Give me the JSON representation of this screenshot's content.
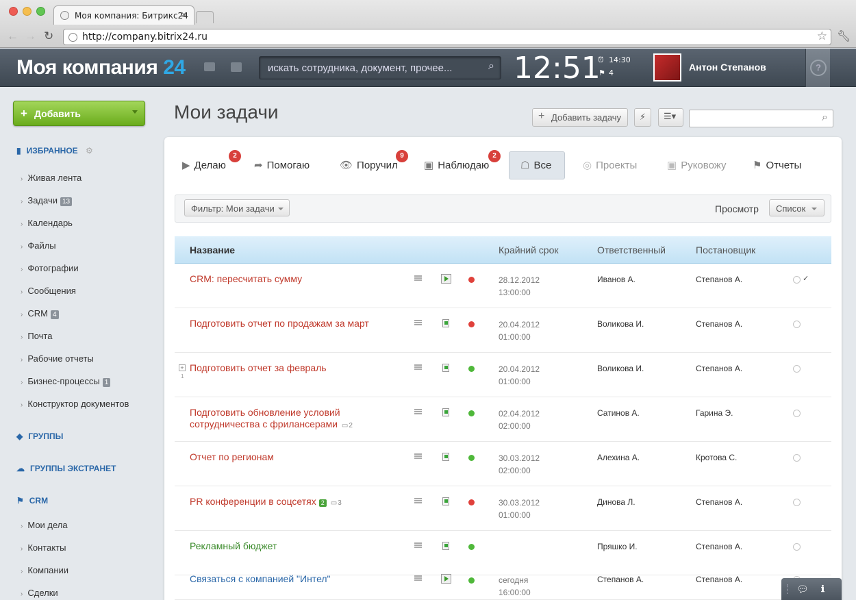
{
  "browser": {
    "tab_title": "Моя компания: Битрикс24",
    "url": "http://company.bitrix24.ru"
  },
  "header": {
    "logo_text": "Моя компания",
    "logo_number": "24",
    "search_placeholder": "искать сотрудника, документ, прочее...",
    "clock": "12:51",
    "alarm_time": "14:30",
    "flag_count": "4",
    "user_name": "Антон Степанов",
    "help_label": "?"
  },
  "sidebar": {
    "add_button": "Добавить",
    "favorites_title": "ИЗБРАННОЕ",
    "favorites": [
      {
        "label": "Живая лента",
        "count": ""
      },
      {
        "label": "Задачи",
        "count": "13"
      },
      {
        "label": "Календарь",
        "count": ""
      },
      {
        "label": "Файлы",
        "count": ""
      },
      {
        "label": "Фотографии",
        "count": ""
      },
      {
        "label": "Сообщения",
        "count": ""
      },
      {
        "label": "CRM",
        "count": "4"
      },
      {
        "label": "Почта",
        "count": ""
      },
      {
        "label": "Рабочие отчеты",
        "count": ""
      },
      {
        "label": "Бизнес-процессы",
        "count": "1"
      },
      {
        "label": "Конструктор документов",
        "count": ""
      }
    ],
    "groups_title": "ГРУППЫ",
    "extranet_title": "ГРУППЫ ЭКСТРАНЕТ",
    "crm_title": "CRM",
    "crm_items": [
      "Мои дела",
      "Контакты",
      "Компании",
      "Сделки"
    ]
  },
  "page": {
    "title": "Мои задачи",
    "add_task_button": "Добавить задачу"
  },
  "filter_tabs": [
    {
      "label": "Делаю",
      "badge": "2"
    },
    {
      "label": "Помогаю",
      "badge": ""
    },
    {
      "label": "Поручил",
      "badge": "9"
    },
    {
      "label": "Наблюдаю",
      "badge": "2"
    },
    {
      "label": "Все",
      "badge": ""
    },
    {
      "label": "Проекты",
      "badge": ""
    },
    {
      "label": "Руковожу",
      "badge": ""
    },
    {
      "label": "Отчеты",
      "badge": ""
    }
  ],
  "filter_bar": {
    "filter_label": "Фильтр: Мои задачи",
    "view_label": "Просмотр",
    "view_value": "Список"
  },
  "table": {
    "columns": [
      "Название",
      "Крайний срок",
      "Ответственный",
      "Постановщик"
    ],
    "rows": [
      {
        "name": "CRM: пересчитать сумму",
        "date": "28.12.2012",
        "time": "13:00:00",
        "responsible": "Иванов А.",
        "creator": "Степанов А.",
        "status": "red",
        "color": "#c0392b"
      },
      {
        "name": "Подготовить отчет по продажам за март",
        "date": "20.04.2012",
        "time": "01:00:00",
        "responsible": "Воликова И.",
        "creator": "Степанов А.",
        "status": "red",
        "color": "#c0392b"
      },
      {
        "name": "Подготовить отчет за февраль",
        "date": "20.04.2012",
        "time": "01:00:00",
        "responsible": "Воликова И.",
        "creator": "Степанов А.",
        "status": "green",
        "color": "#c0392b",
        "subcount": "1"
      },
      {
        "name": "Подготовить обновление условий",
        "name2": "сотрудничества с фрилансерами",
        "comments": "2",
        "date": "02.04.2012",
        "time": "02:00:00",
        "responsible": "Сатинов А.",
        "creator": "Гарина Э.",
        "status": "green",
        "color": "#c0392b"
      },
      {
        "name": "Отчет по регионам",
        "date": "30.03.2012",
        "time": "02:00:00",
        "responsible": "Алехина А.",
        "creator": "Кротова С.",
        "status": "green",
        "color": "#c0392b"
      },
      {
        "name": "PR конференции в соцсетях",
        "tag": "2",
        "comments": "3",
        "date": "30.03.2012",
        "time": "01:00:00",
        "responsible": "Динова Л.",
        "creator": "Степанов А.",
        "status": "red",
        "color": "#c0392b"
      },
      {
        "name": "Рекламный бюджет",
        "date": "",
        "time": "",
        "responsible": "Пряшко И.",
        "creator": "Степанов А.",
        "status": "green",
        "color": "#3a8a2a"
      },
      {
        "name": "Связаться с компанией \"Интел\"",
        "date": "сегодня",
        "time": "16:00:00",
        "responsible": "Степанов А.",
        "creator": "Степанов А.",
        "status": "green",
        "color": "#2a67a8"
      }
    ]
  }
}
